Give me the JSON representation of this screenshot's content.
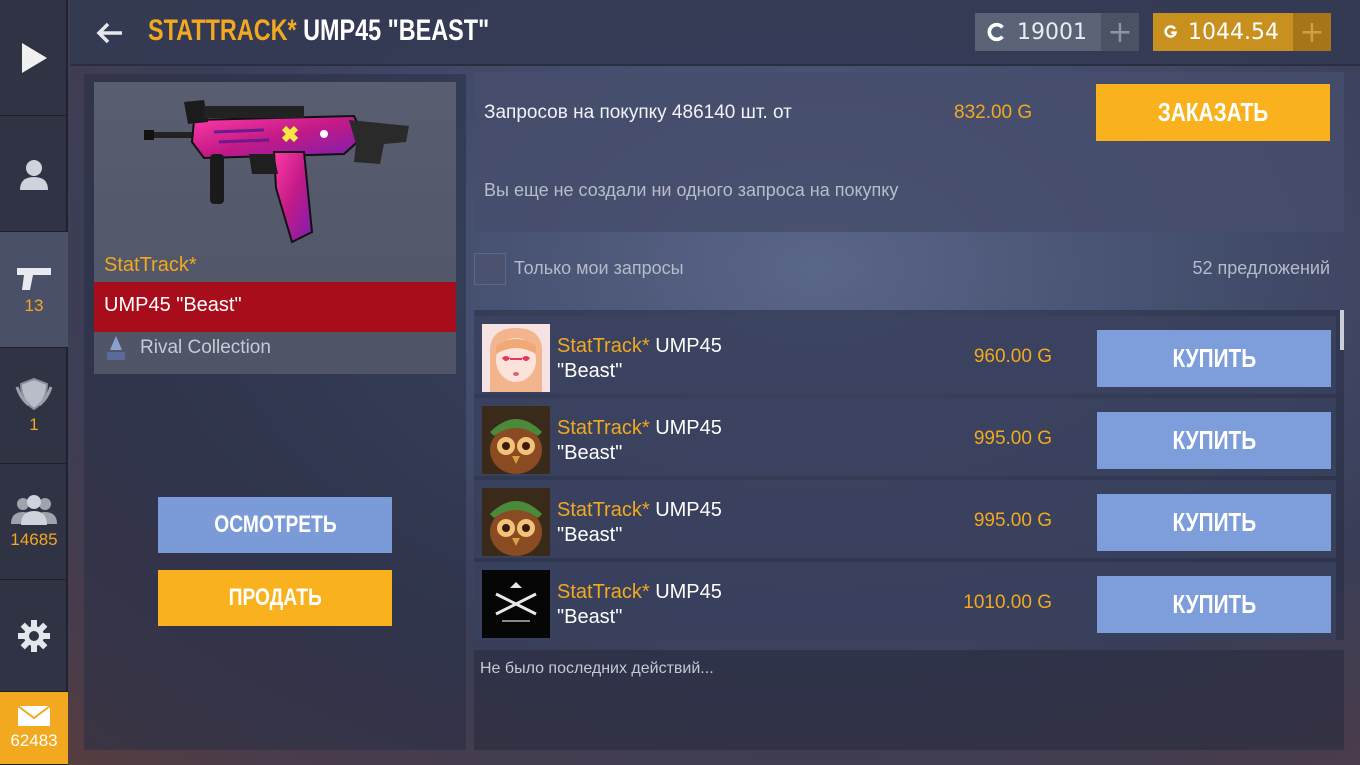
{
  "sidebar": {
    "items": [
      {
        "name": "play",
        "count": ""
      },
      {
        "name": "profile",
        "count": ""
      },
      {
        "name": "inventory",
        "count": "13"
      },
      {
        "name": "clan",
        "count": "1"
      },
      {
        "name": "friends",
        "count": "14685"
      },
      {
        "name": "settings",
        "count": ""
      },
      {
        "name": "mail",
        "count": "62483"
      }
    ]
  },
  "header": {
    "title_prefix": "STATTRACK*",
    "title_name": "UMP45 \"BEAST\"",
    "credits": "19001",
    "gold": "1044.54",
    "plus": "+"
  },
  "item": {
    "stattrack_label": "StatTrack*",
    "name": "UMP45 \"Beast\"",
    "collection": "Rival Collection",
    "inspect_label": "ОСМОТРЕТЬ",
    "sell_label": "ПРОДАТЬ"
  },
  "order": {
    "requests_text": "Запросов на покупку 486140 шт. от",
    "min_price": "832.00 G",
    "order_label": "ЗАКАЗАТЬ",
    "empty_text": "Вы еще не создали ни одного запроса на покупку"
  },
  "filter": {
    "only_mine_label": "Только мои запросы",
    "offer_count": "52 предложений"
  },
  "offers": [
    {
      "stattrack": "StatTrack*",
      "weapon": "UMP45",
      "skin": "\"Beast\"",
      "price": "960.00 G",
      "buy_label": "КУПИТЬ",
      "avatar": "anime-girl"
    },
    {
      "stattrack": "StatTrack*",
      "weapon": "UMP45",
      "skin": "\"Beast\"",
      "price": "995.00 G",
      "buy_label": "КУПИТЬ",
      "avatar": "owl"
    },
    {
      "stattrack": "StatTrack*",
      "weapon": "UMP45",
      "skin": "\"Beast\"",
      "price": "995.00 G",
      "buy_label": "КУПИТЬ",
      "avatar": "owl"
    },
    {
      "stattrack": "StatTrack*",
      "weapon": "UMP45",
      "skin": "\"Beast\"",
      "price": "1010.00 G",
      "buy_label": "КУПИТЬ",
      "avatar": "crossed-guns-logo"
    }
  ],
  "history": {
    "text": "Не было последних действий..."
  },
  "colors": {
    "accent": "#f2a81f",
    "buy_button": "#7d9ddb",
    "name_bar": "#a80d1b"
  }
}
